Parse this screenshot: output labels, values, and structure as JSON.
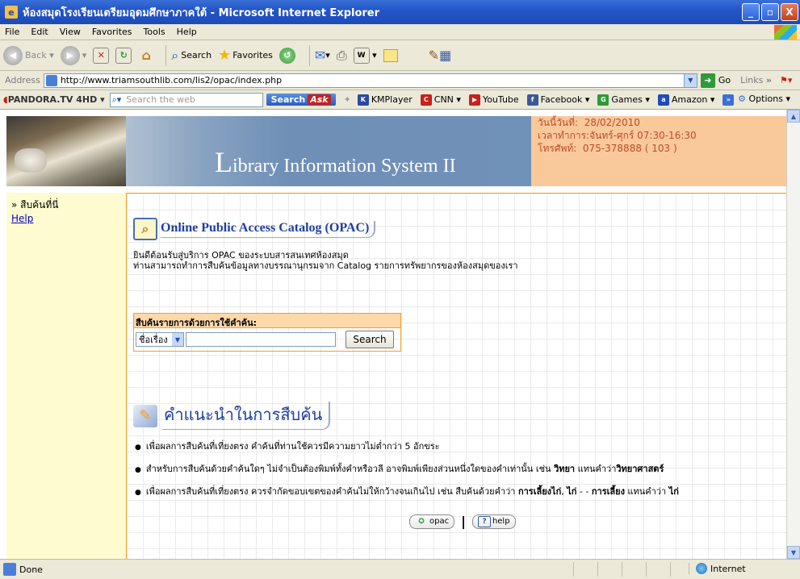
{
  "window": {
    "title": "ห้องสมุดโรงเรียนเตรียมอุดมศึกษาภาคใต้ - Microsoft Internet Explorer",
    "buttons": {
      "minimize": "_",
      "maximize": "▫",
      "close": "X"
    }
  },
  "menu": [
    "File",
    "Edit",
    "View",
    "Favorites",
    "Tools",
    "Help"
  ],
  "toolbar": {
    "back": "Back",
    "search": "Search",
    "favorites": "Favorites"
  },
  "address": {
    "label": "Address",
    "url": "http://www.triamsouthlib.com/lis2/opac/index.php",
    "go": "Go",
    "links": "Links"
  },
  "pandora_bar": {
    "brand": "PANDORA.TV 4HD",
    "search_placeholder": "Search the web",
    "search_button": "Search",
    "ask": "Ask",
    "links": [
      {
        "label": "KMPlayer",
        "color": "#2a4aa0"
      },
      {
        "label": "CNN",
        "color": "#c8201a"
      },
      {
        "label": "YouTube",
        "color": "#c8201a"
      },
      {
        "label": "Facebook",
        "color": "#3b5998"
      },
      {
        "label": "Games",
        "color": "#2f9a3a"
      },
      {
        "label": "Amazon",
        "color": "#1d4bb8"
      }
    ],
    "options": "Options"
  },
  "banner": {
    "system_title_cap": "L",
    "system_title_rest": "ibrary Information System II",
    "date_label": "วันนี้วันที่:",
    "date_value": "28/02/2010",
    "hours_label": "เวลาทำการ:",
    "hours_value": "จันทร์-ศุกร์ 07:30-16:30",
    "phone_label": "โทรศัพท์:",
    "phone_value": "075-378888 ( 103 )"
  },
  "sidebar": {
    "current": "» สืบค้นที่นี่",
    "help": "Help"
  },
  "opac": {
    "title": "Online Public Access Catalog (OPAC)",
    "welcome_line1": "ยินดีต้อนรับสู่บริการ OPAC ของระบบสารสนเทศห้องสมุด",
    "welcome_line2": "ท่านสามารถทำการสืบค้นข้อมูลทางบรรณานุกรมจาก Catalog รายการทรัพยากรของห้องสมุดของเรา"
  },
  "search": {
    "header": "สืบค้นรายการด้วยการใช้คำค้น:",
    "field_selected": "ชื่อเรื่อง",
    "query_value": "",
    "button": "Search"
  },
  "guide": {
    "title": "คำแนะนำในการสืบค้น",
    "tip1": "เพื่อผลการสืบค้นที่เที่ยงตรง คำค้นที่ท่านใช้ควรมีความยาวไม่ต่ำกว่า 5 อักขระ",
    "tip2_a": "สำหรับการสืบค้นด้วยคำค้นใดๆ ไม่จำเป็นต้องพิมพ์ทั้งคำหรือวลี อาจพิมพ์เพียงส่วนหนึ่งใดของคำเท่านั้น เช่น",
    "tip2_b": "วิทยา",
    "tip2_c": "แทนคำว่า",
    "tip2_d": "วิทยาศาสตร์",
    "tip3_a": "เพื่อผลการสืบค้นที่เที่ยงตรง ควรจำกัดขอบเขตของคำค้นไม่ให้กว้างจนเกินไป เช่น สืบค้นด้วยคำว่า",
    "tip3_b": "การเลี้ยงไก่",
    "tip3_c": ", ",
    "tip3_d": "ไก่",
    "tip3_e": " - - ",
    "tip3_f": "การเลี้ยง",
    "tip3_g": " แทนคำว่า ",
    "tip3_h": "ไก่"
  },
  "footer_links": {
    "opac": "opac",
    "separator": "|",
    "help": "help"
  },
  "status": {
    "text": "Done",
    "zone": "Internet"
  }
}
